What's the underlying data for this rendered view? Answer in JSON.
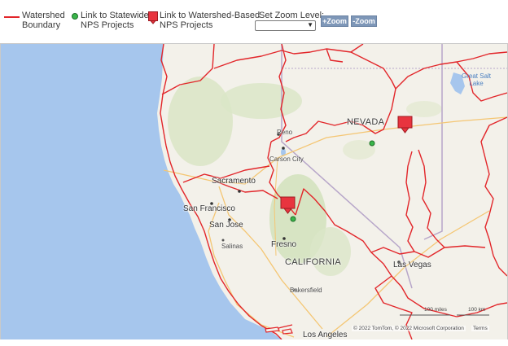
{
  "legend": {
    "watershed_line1": "Watershed",
    "watershed_line2": "Boundary",
    "statewide_line1": "Link to Statewide",
    "statewide_line2": "NPS Projects",
    "watershed_based_line1": "Link to Watershed-Based",
    "watershed_based_line2": "NPS Projects"
  },
  "zoom": {
    "label": "Set Zoom Level:",
    "selected": "",
    "zoom_in": "+Zoom",
    "zoom_out": "-Zoom"
  },
  "map": {
    "state_nevada": "NEVADA",
    "state_california": "CALIFORNIA",
    "lake_1": "Great Salt",
    "lake_2": "Lake",
    "cities": {
      "reno": "Reno",
      "carson_city": "Carson City",
      "sacramento": "Sacramento",
      "san_francisco": "San Francisco",
      "san_jose": "San Jose",
      "salinas": "Salinas",
      "fresno": "Fresno",
      "bakersfield": "Bakersfield",
      "las_vegas": "Las Vegas",
      "los_angeles": "Los Angeles"
    },
    "scale_miles": "100 miles",
    "scale_km": "100 km",
    "attribution": "© 2022 TomTom, © 2022 Microsoft Corporation",
    "terms": "Terms"
  },
  "colors": {
    "watershed": "#e2262a",
    "statewide_marker": "#39b54a",
    "watershed_marker": "#e8343f",
    "ocean": "#a6c6ed",
    "land": "#f3f1ea"
  }
}
